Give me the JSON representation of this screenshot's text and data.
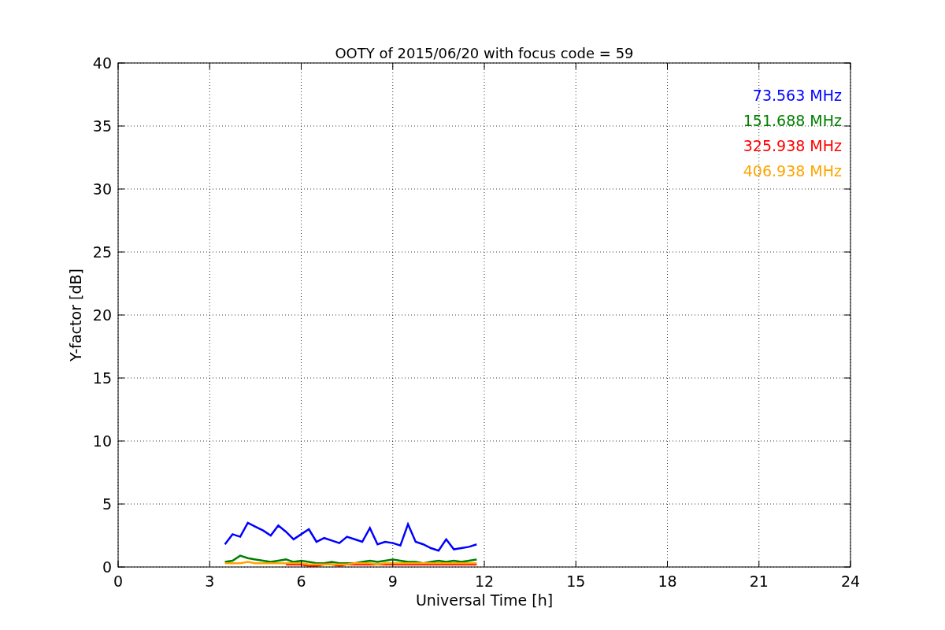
{
  "chart_data": {
    "type": "line",
    "title": "OOTY of 2015/06/20 with focus code = 59",
    "xlabel": "Universal Time [h]",
    "ylabel": "Y-factor [dB]",
    "x": [
      3.5,
      3.75,
      4,
      4.25,
      4.5,
      4.75,
      5,
      5.25,
      5.5,
      5.75,
      6,
      6.25,
      6.5,
      6.75,
      7,
      7.25,
      7.5,
      7.75,
      8,
      8.25,
      8.5,
      8.75,
      9,
      9.25,
      9.5,
      9.75,
      10,
      10.25,
      10.5,
      10.75,
      11,
      11.25,
      11.5,
      11.75
    ],
    "series": [
      {
        "name": "73.563 MHz",
        "color": "#0000ff",
        "values": [
          1.8,
          2.6,
          2.4,
          3.5,
          3.2,
          2.9,
          2.5,
          3.3,
          2.8,
          2.2,
          2.6,
          3.0,
          2.0,
          2.3,
          2.1,
          1.9,
          2.4,
          2.2,
          2.0,
          3.1,
          1.8,
          2.0,
          1.9,
          1.7,
          3.4,
          2.0,
          1.8,
          1.5,
          1.3,
          2.2,
          1.4,
          1.5,
          1.6,
          1.8
        ]
      },
      {
        "name": "151.688 MHz",
        "color": "#008000",
        "values": [
          0.4,
          0.5,
          0.9,
          0.7,
          0.6,
          0.5,
          0.4,
          0.5,
          0.6,
          0.4,
          0.5,
          0.4,
          0.3,
          0.3,
          0.4,
          0.3,
          0.3,
          0.3,
          0.4,
          0.5,
          0.4,
          0.5,
          0.6,
          0.5,
          0.4,
          0.4,
          0.3,
          0.4,
          0.5,
          0.4,
          0.5,
          0.4,
          0.5,
          0.6
        ]
      },
      {
        "name": "325.938 MHz",
        "color": "#ff0000",
        "values": [
          null,
          null,
          null,
          null,
          null,
          null,
          null,
          null,
          0.2,
          0.2,
          0.2,
          0.1,
          0.1,
          0.2,
          0.2,
          0.1,
          0.2,
          0.2,
          0.2,
          0.2,
          0.2,
          0.2,
          0.2,
          0.2,
          0.2,
          0.2,
          0.2,
          0.2,
          0.2,
          0.2,
          0.2,
          0.2,
          0.2,
          0.2
        ]
      },
      {
        "name": "406.938 MHz",
        "color": "#ffa500",
        "values": [
          0.3,
          0.3,
          0.3,
          0.4,
          0.3,
          0.3,
          0.3,
          0.3,
          0.3,
          0.3,
          0.3,
          0.2,
          0.2,
          0.2,
          0.2,
          0.2,
          0.2,
          0.3,
          0.3,
          0.3,
          0.2,
          0.3,
          0.3,
          0.3,
          0.3,
          0.3,
          0.3,
          0.3,
          0.3,
          0.3,
          0.3,
          0.3,
          0.3,
          0.3
        ]
      }
    ],
    "xlim": [
      0,
      24
    ],
    "ylim": [
      0,
      40
    ],
    "xticks": [
      0,
      3,
      6,
      9,
      12,
      15,
      18,
      21,
      24
    ],
    "yticks": [
      0,
      5,
      10,
      15,
      20,
      25,
      30,
      35,
      40
    ],
    "grid": true
  }
}
